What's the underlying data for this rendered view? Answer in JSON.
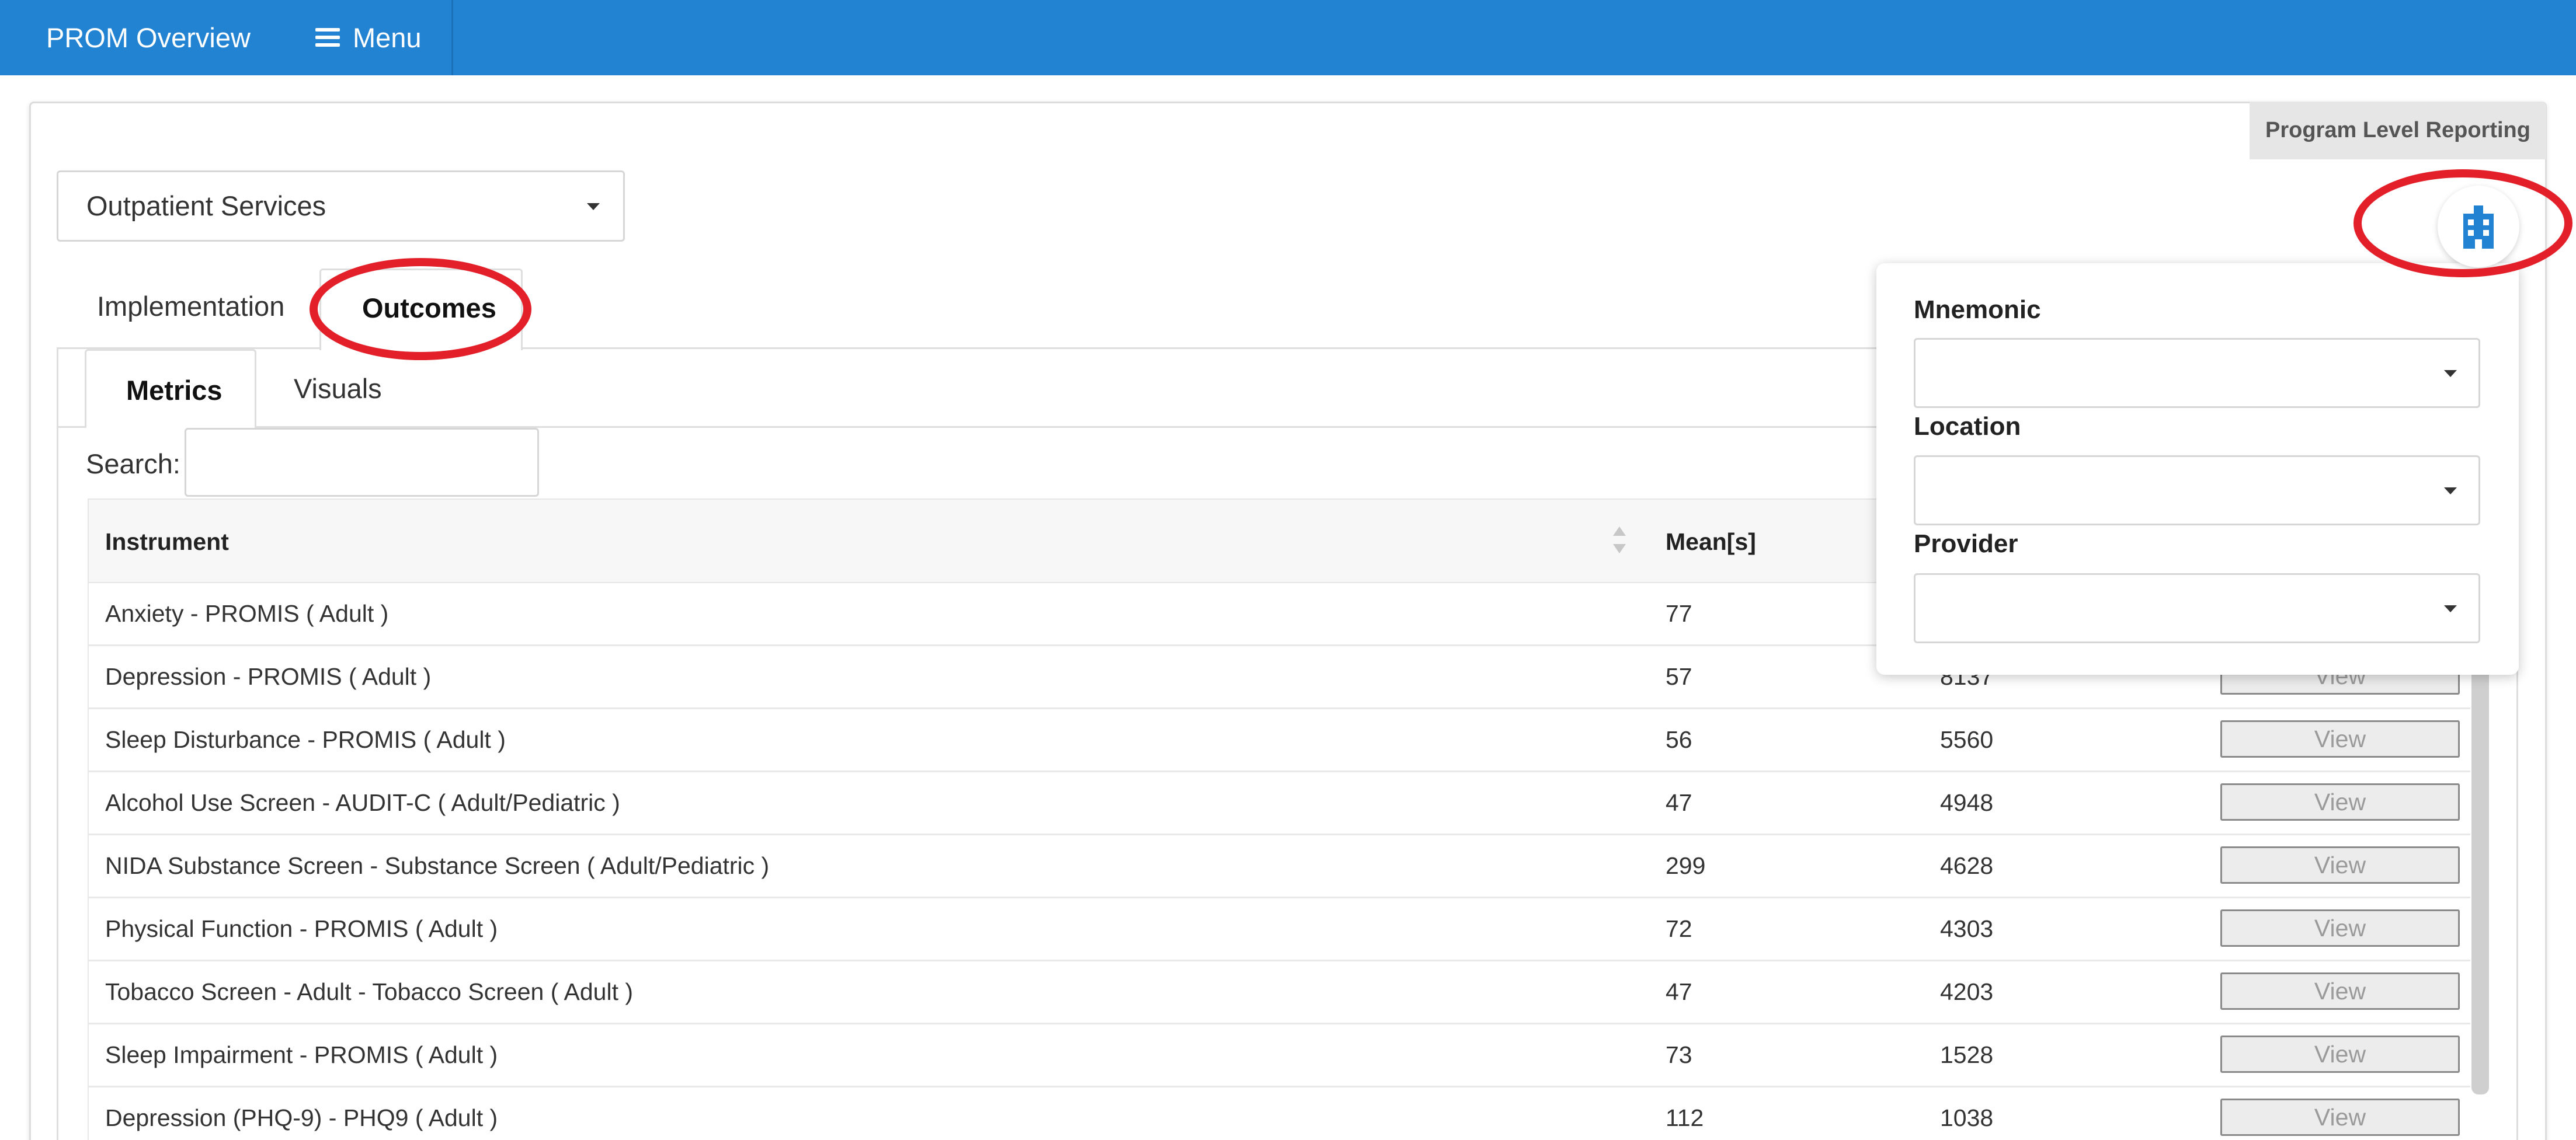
{
  "topbar": {
    "title": "PROM Overview",
    "menu_label": "Menu",
    "color": "#2283d3"
  },
  "header": {
    "reporting_tag": "Program Level Reporting"
  },
  "program_select": {
    "value": "Outpatient Services"
  },
  "tabs": [
    {
      "label": "Implementation",
      "active": false
    },
    {
      "label": "Outcomes",
      "active": true
    }
  ],
  "subtabs": [
    {
      "label": "Metrics",
      "active": true
    },
    {
      "label": "Visuals",
      "active": false
    }
  ],
  "search": {
    "label": "Search:",
    "value": ""
  },
  "table": {
    "columns": [
      "Instrument",
      "Mean[s]",
      "",
      ""
    ],
    "rows": [
      {
        "instrument": "Anxiety - PROMIS ( Adult )",
        "mean": "77",
        "count": "",
        "action": "View"
      },
      {
        "instrument": "Depression - PROMIS ( Adult )",
        "mean": "57",
        "count": "8137",
        "action": "View"
      },
      {
        "instrument": "Sleep Disturbance - PROMIS ( Adult )",
        "mean": "56",
        "count": "5560",
        "action": "View"
      },
      {
        "instrument": "Alcohol Use Screen - AUDIT-C ( Adult/Pediatric )",
        "mean": "47",
        "count": "4948",
        "action": "View"
      },
      {
        "instrument": "NIDA Substance Screen - Substance Screen ( Adult/Pediatric )",
        "mean": "299",
        "count": "4628",
        "action": "View"
      },
      {
        "instrument": "Physical Function - PROMIS ( Adult )",
        "mean": "72",
        "count": "4303",
        "action": "View"
      },
      {
        "instrument": "Tobacco Screen - Adult - Tobacco Screen ( Adult )",
        "mean": "47",
        "count": "4203",
        "action": "View"
      },
      {
        "instrument": "Sleep Impairment - PROMIS ( Adult )",
        "mean": "73",
        "count": "1528",
        "action": "View"
      },
      {
        "instrument": "Depression (PHQ-9) - PHQ9 ( Adult )",
        "mean": "112",
        "count": "1038",
        "action": "View"
      }
    ]
  },
  "filters": {
    "mnemonic": {
      "label": "Mnemonic",
      "value": ""
    },
    "location": {
      "label": "Location",
      "value": ""
    },
    "provider": {
      "label": "Provider",
      "value": ""
    }
  },
  "icons": {
    "filter_button": "building-icon",
    "menu": "hamburger-icon",
    "dropdown": "caret-down-icon",
    "sort": "sort-icon"
  },
  "colors": {
    "accent": "#2283d3",
    "annotation": "#e3202a",
    "building_icon": "#2283d3"
  }
}
